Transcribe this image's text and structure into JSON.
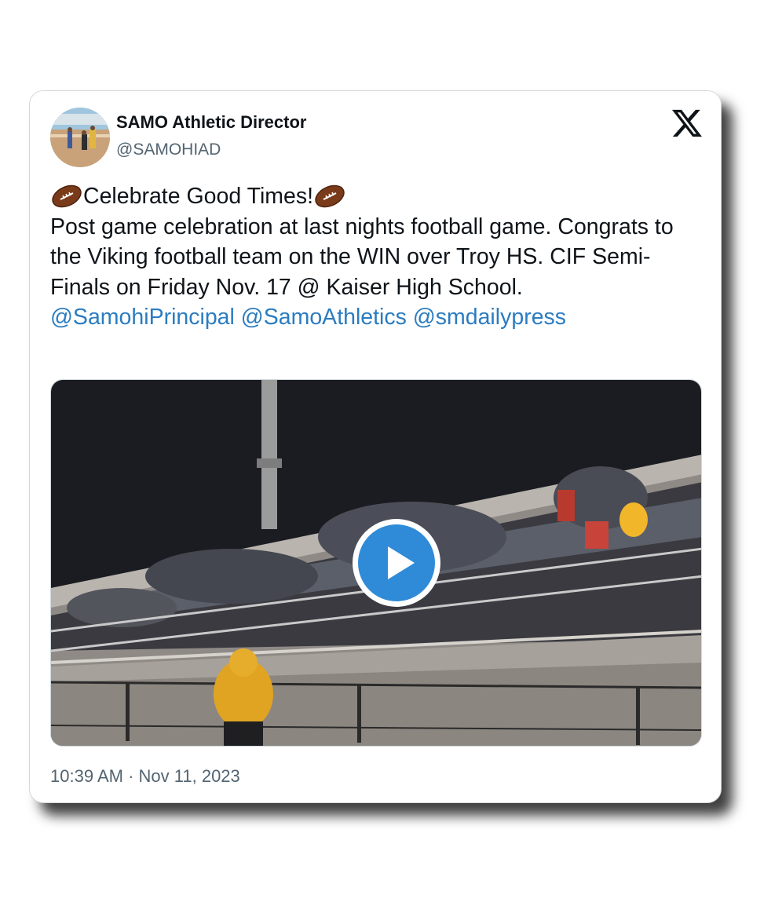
{
  "tweet": {
    "author_name": "SAMO Athletic Director",
    "author_handle": "@SAMOHIAD",
    "headline": "Celebrate Good Times!",
    "body_text": "Post game celebration at last nights football game. Congrats to the Viking football team on the WIN over Troy HS.  CIF Semi-Finals on Friday Nov. 17 @ Kaiser High School.",
    "mentions": [
      "@SamohiPrincipal",
      "@SamoAthletics",
      "@smdailypress"
    ],
    "time": "10:39 AM",
    "separator": "·",
    "date": "Nov 11, 2023"
  },
  "icons": {
    "logo": "x-logo-icon",
    "emoji": "american-football-icon",
    "play": "play-icon"
  },
  "colors": {
    "mention": "#2b7cc1",
    "play_button": "#2f8bd8",
    "text": "#0f1419",
    "secondary_text": "#536471"
  }
}
